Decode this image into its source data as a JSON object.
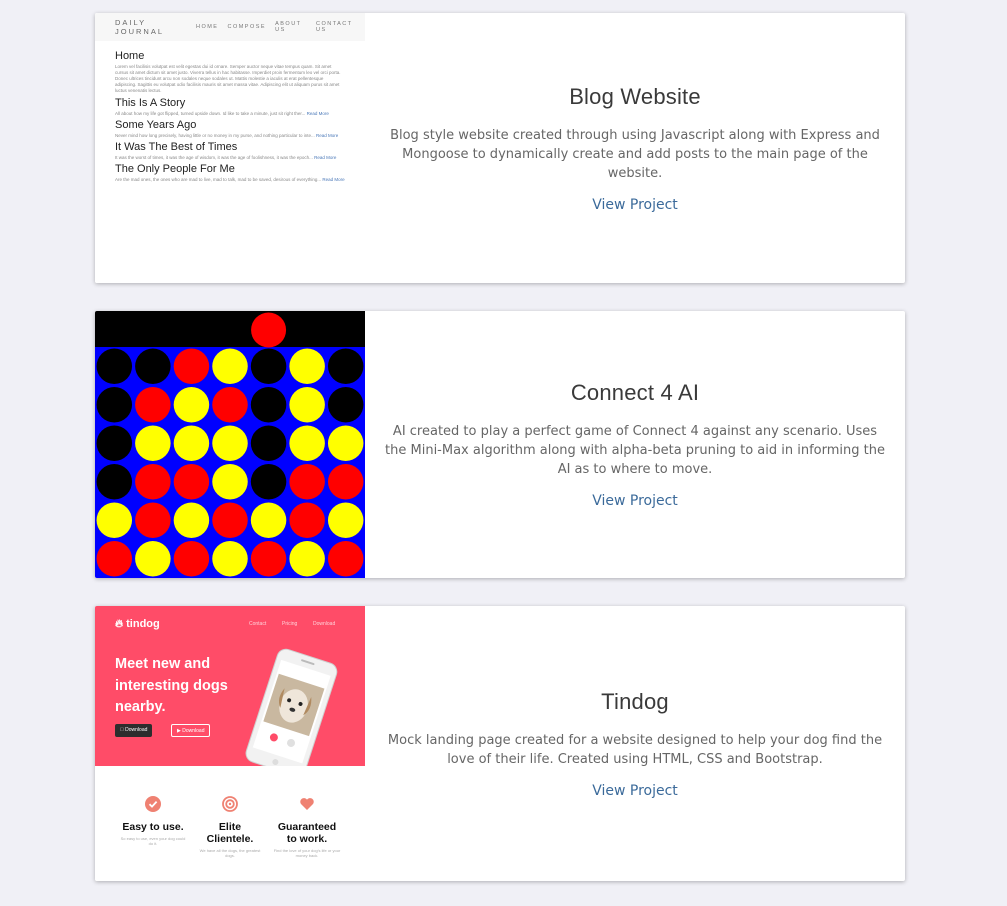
{
  "projects": [
    {
      "title": "Blog Website",
      "description": "Blog style website created through using Javascript along with Express and Mongoose to dynamically create and add posts to the main page of the website.",
      "link": "View Project",
      "thumbnail": {
        "brand": "DAILY JOURNAL",
        "nav": [
          "HOME",
          "COMPOSE",
          "ABOUT US",
          "CONTACT US"
        ],
        "page_title": "Home",
        "lorem": "Lorem vel facilisis volutpat est velit egestas dui id ornare. Semper auctor neque vitae tempus quam. Sit amet cursus sit amet dictum sit amet justo. Viverra tellus in hac habitasse. Imperdiet proin fermentum leo vel orci porta. Donec ultrices tincidunt arcu non sodales neque sodales ut. Mattis molestie a iaculis at erat pellentesque adipiscing. Sagittis eu volutpat odio facilisis mauris sit amet massa vitae. Adipiscing elit ut aliquam purus sit amet luctus venenatis lectus.",
        "read_more": "Read More",
        "posts": [
          {
            "title": "This Is A Story",
            "excerpt": "All about how my life got flipped, turned upside down. Id like to take a minute, just sit right ther..."
          },
          {
            "title": "Some Years Ago",
            "excerpt": "Never mind how long precisely, having little or no money in my purse, and nothing particular to inte..."
          },
          {
            "title": "It Was The Best of Times",
            "excerpt": "It was the worst of times, it was the age of wisdom, it was the age of foolishness, it was the epoch..."
          },
          {
            "title": "The Only People For Me",
            "excerpt": "Are the mad ones, the ones who are mad to live, mad to talk, mad to be saved, desirous of everything..."
          }
        ]
      }
    },
    {
      "title": "Connect 4 AI",
      "description": "AI created to play a perfect game of Connect 4 against any scenario. Uses the Mini-Max algorithm along with alpha-beta pruning to aid in informing the AI as to where to move.",
      "link": "View Project",
      "thumbnail": {
        "colors": {
          "board": "#0000ff",
          "red": "#ff0000",
          "yellow": "#ffff00",
          "black": "#000000"
        },
        "drop_piece": {
          "column": 4,
          "color": "red"
        },
        "grid": [
          [
            "black",
            "black",
            "red",
            "yellow",
            "black",
            "yellow",
            "black"
          ],
          [
            "black",
            "red",
            "yellow",
            "red",
            "black",
            "yellow",
            "black"
          ],
          [
            "black",
            "yellow",
            "yellow",
            "yellow",
            "black",
            "yellow",
            "yellow"
          ],
          [
            "black",
            "red",
            "red",
            "yellow",
            "black",
            "red",
            "red"
          ],
          [
            "yellow",
            "red",
            "yellow",
            "red",
            "yellow",
            "red",
            "yellow"
          ],
          [
            "red",
            "yellow",
            "red",
            "yellow",
            "red",
            "yellow",
            "red"
          ]
        ]
      }
    },
    {
      "title": "Tindog",
      "description": "Mock landing page created for a website designed to help your dog find the love of their life. Created using HTML, CSS and Bootstrap.",
      "link": "View Project",
      "thumbnail": {
        "brand": "tindog",
        "nav": [
          "Contact",
          "Pricing",
          "Download"
        ],
        "headline": "Meet new and interesting dogs nearby.",
        "buttons": [
          "Download",
          "Download"
        ],
        "brand_color": "#ff4c68",
        "features": [
          {
            "title": "Easy to use.",
            "sub": "So easy to use, even your dog could do it.",
            "icon": "check-circle-icon"
          },
          {
            "title": "Elite Clientele.",
            "sub": "We have all the dogs, the greatest dogs.",
            "icon": "bullseye-icon"
          },
          {
            "title": "Guaranteed to work.",
            "sub": "Find the love of your dog's life or your money back.",
            "icon": "heart-icon"
          }
        ]
      }
    }
  ]
}
